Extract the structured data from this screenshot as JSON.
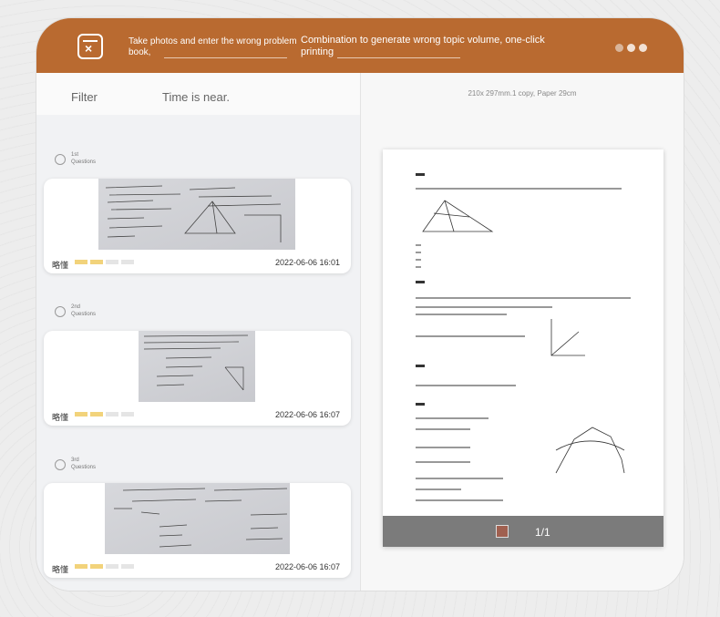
{
  "header": {
    "hint_photo": "Take photos and enter the wrong problem book,",
    "hint_print": "Combination to generate wrong topic volume, one-click printing"
  },
  "filters": {
    "filter_label": "Filter",
    "time_label": "Time is near."
  },
  "questions": [
    {
      "ordinal": "1st",
      "label": "Questions",
      "mastery_label": "略懂",
      "level": 2,
      "levels_total": 4,
      "date": "2022-06-06 16:01"
    },
    {
      "ordinal": "2nd",
      "label": "Questions",
      "mastery_label": "略懂",
      "level": 2,
      "levels_total": 4,
      "date": "2022-06-06 16:07"
    },
    {
      "ordinal": "3rd",
      "label": "Questions",
      "mastery_label": "略懂",
      "level": 2,
      "levels_total": 4,
      "date": "2022-06-06 16:07"
    }
  ],
  "preview": {
    "paper_spec": "210x 297mm.1 copy, Paper 29cm",
    "page_indicator": "1/1"
  },
  "colors": {
    "header_bg": "#b96a30",
    "mastery_on": "#f2d37b",
    "mastery_off": "#e5e5e5",
    "preview_footer": "#7b7b7b"
  }
}
